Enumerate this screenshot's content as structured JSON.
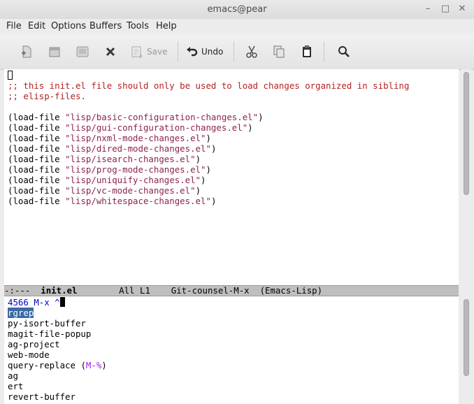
{
  "window": {
    "title": "emacs@pear",
    "minimize_glyph": "–",
    "maximize_glyph": "□",
    "close_glyph": "✕"
  },
  "menubar": [
    "File",
    "Edit",
    "Options",
    "Buffers",
    "Tools",
    "Help"
  ],
  "toolbar": {
    "buttons": [
      {
        "icon": "new-file-icon",
        "label": ""
      },
      {
        "icon": "open-folder-icon",
        "label": ""
      },
      {
        "icon": "dired-icon",
        "label": ""
      },
      {
        "icon": "close-buffer-icon",
        "label": ""
      },
      {
        "icon": "save-icon",
        "label": "Save",
        "disabled": true
      },
      {
        "icon": "undo-icon",
        "label": "Undo"
      },
      {
        "icon": "cut-icon",
        "label": ""
      },
      {
        "icon": "copy-icon",
        "label": ""
      },
      {
        "icon": "paste-icon",
        "label": ""
      },
      {
        "icon": "search-icon",
        "label": ""
      }
    ],
    "save_label": "Save",
    "undo_label": "Undo"
  },
  "editor": {
    "comment_lines": [
      ";; this init.el file should only be used to load changes organized in sibling",
      ";; elisp-files."
    ],
    "load_call": "(load-file ",
    "load_files": [
      "\"lisp/basic-configuration-changes.el\"",
      "\"lisp/gui-configuration-changes.el\"",
      "\"lisp/nxml-mode-changes.el\"",
      "\"lisp/dired-mode-changes.el\"",
      "\"lisp/isearch-changes.el\"",
      "\"lisp/prog-mode-changes.el\"",
      "\"lisp/uniquify-changes.el\"",
      "\"lisp/vc-mode-changes.el\"",
      "\"lisp/whitespace-changes.el\""
    ],
    "close_paren": ")"
  },
  "modeline": {
    "status": "-:---",
    "buffer_name": "init.el",
    "position": "All L1",
    "minor": "Git-counsel-M-x",
    "major_mode": "(Emacs-Lisp)"
  },
  "minibuffer": {
    "count": "4566",
    "prompt": "M-x ^",
    "candidates": [
      {
        "name": "rgrep",
        "selected": true
      },
      {
        "name": "py-isort-buffer"
      },
      {
        "name": "magit-file-popup"
      },
      {
        "name": "ag-project"
      },
      {
        "name": "web-mode"
      },
      {
        "name": "query-replace",
        "key_open": " (",
        "key": "M-%",
        "key_close": ")"
      },
      {
        "name": "ag"
      },
      {
        "name": "ert"
      },
      {
        "name": "revert-buffer"
      }
    ]
  },
  "colors": {
    "comment": "#b22222",
    "string": "#8b2252",
    "keybinding": "#a020f0",
    "selection": "#3a6ba5",
    "count": "#0000cd"
  }
}
